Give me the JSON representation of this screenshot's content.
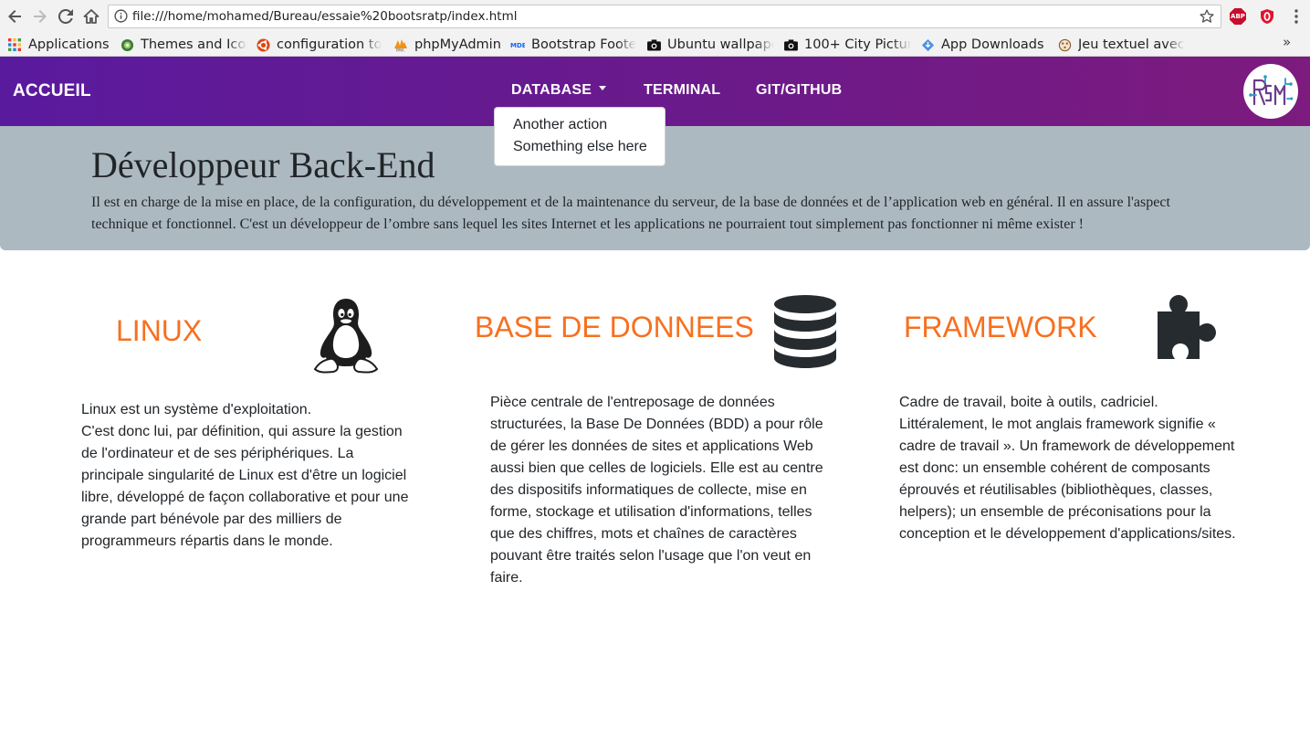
{
  "browser": {
    "url": "file:///home/mohamed/Bureau/essaie%20bootsratp/index.html",
    "extensions": [
      {
        "name": "adblock-plus-icon",
        "label": "ABP",
        "color": "#c70d2c"
      },
      {
        "name": "opera-vpn-icon",
        "label": "",
        "color": "#e0142d"
      }
    ],
    "bookmarks": [
      {
        "icon": "apps-grid-icon",
        "label": "Applications"
      },
      {
        "icon": "themes-icon",
        "label": "Themes and Icon"
      },
      {
        "icon": "ubuntu-icon",
        "label": "configuration to"
      },
      {
        "icon": "phpmyadmin-icon",
        "label": "phpMyAdmin"
      },
      {
        "icon": "mdb-icon",
        "label": "Bootstrap Foote"
      },
      {
        "icon": "camera-icon",
        "label": "Ubuntu wallpape"
      },
      {
        "icon": "camera-icon",
        "label": "100+ City Picture"
      },
      {
        "icon": "download-icon",
        "label": "App Downloads"
      },
      {
        "icon": "game-icon",
        "label": "Jeu textuel avec"
      }
    ],
    "more_label": "»"
  },
  "navbar": {
    "brand": "ACCUEIL",
    "links": [
      {
        "label": "DATABASE",
        "has_dropdown": true
      },
      {
        "label": "TERMINAL",
        "has_dropdown": false
      },
      {
        "label": "GIT/GITHUB",
        "has_dropdown": false
      }
    ],
    "dropdown_items": [
      "Another action",
      "Something else here"
    ],
    "logo_icon": "site-logo-icon",
    "gradient_start": "#5a1a9e",
    "gradient_end": "#7d1b7e"
  },
  "jumbotron": {
    "title": "Développeur Back-End",
    "text": "Il est en charge de la mise en place, de la configuration, du développement et de la maintenance du serveur, de la base de données et de l’application web en général. Il en assure l'aspect technique et fonctionnel. C'est un développeur de l’ombre sans lequel les sites Internet et les applications ne pourraient tout simplement pas fonctionner ni même exister !",
    "background": "#adb9c1"
  },
  "columns": [
    {
      "title": "LINUX",
      "icon": "linux-penguin-icon",
      "text": "Linux est un système d'exploitation.\nC'est donc lui, par définition, qui assure la gestion de l'ordinateur et de ses périphériques. La principale singularité de Linux est d'être un logiciel libre, développé de façon collaborative et pour une grande part bénévole par des milliers de programmeurs répartis dans le monde."
    },
    {
      "title": "BASE DE DONNEES",
      "icon": "database-icon",
      "text": "Pièce centrale de l'entreposage de données structurées, la Base De Données (BDD) a pour rôle de gérer les données de sites et applications Web aussi bien que celles de logiciels. Elle est au centre des dispositifs informatiques de collecte, mise en forme, stockage et utilisation d'informations, telles que des chiffres, mots et chaînes de caractères pouvant être traités selon l'usage que l'on veut en faire."
    },
    {
      "title": "FRAMEWORK",
      "icon": "puzzle-piece-icon",
      "text": "Cadre de travail, boite à outils, cadriciel. Littéralement, le mot anglais framework signifie « cadre de travail ». Un framework de développement est donc: un ensemble cohérent de composants éprouvés et réutilisables (bibliothèques, classes, helpers); un ensemble de préconisations pour la conception et le développement d'applications/sites."
    }
  ],
  "accent_color": "#f7701f"
}
